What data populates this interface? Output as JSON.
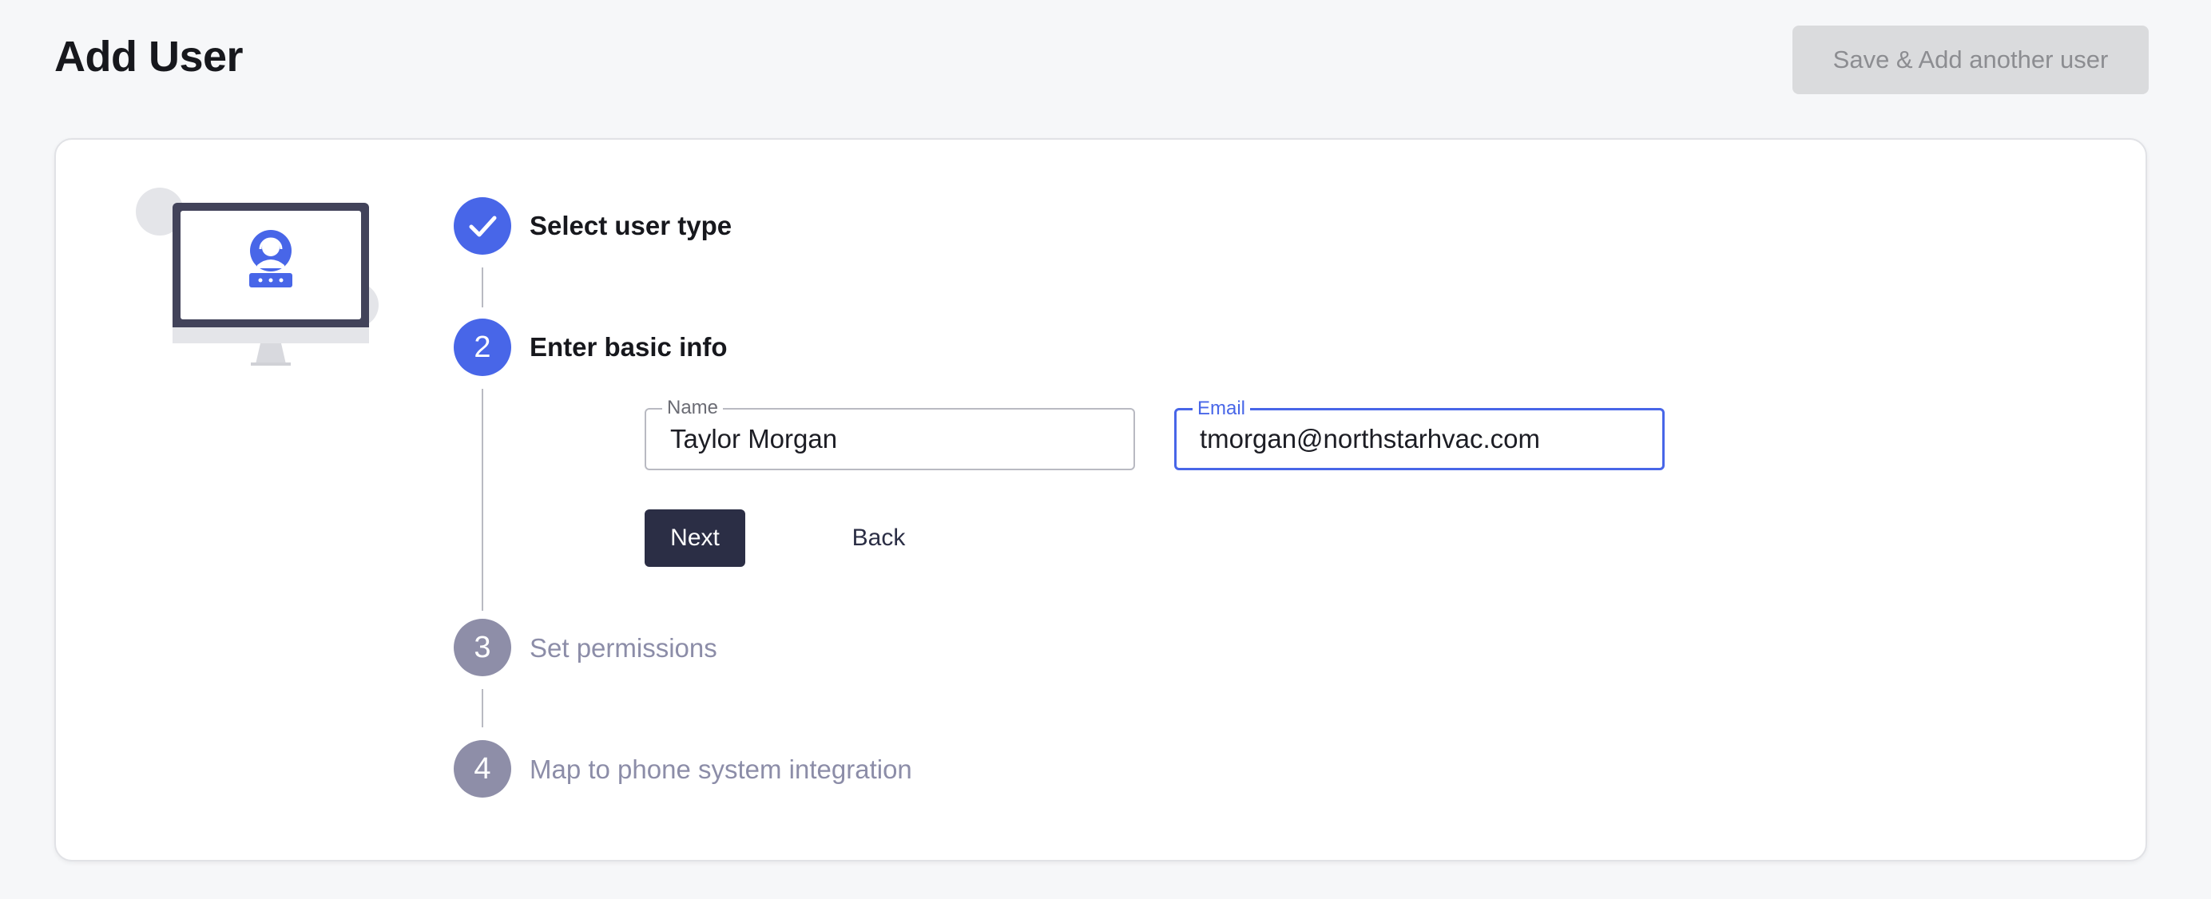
{
  "header": {
    "title": "Add User",
    "save_add_label": "Save & Add another user"
  },
  "steps": [
    {
      "number": "1",
      "label": "Select user type",
      "state": "done"
    },
    {
      "number": "2",
      "label": "Enter basic info",
      "state": "current"
    },
    {
      "number": "3",
      "label": "Set permissions",
      "state": "upcoming"
    },
    {
      "number": "4",
      "label": "Map to phone system integration",
      "state": "upcoming"
    }
  ],
  "form": {
    "name": {
      "label": "Name",
      "value": "Taylor Morgan"
    },
    "email": {
      "label": "Email",
      "value": "tmorgan@northstarhvac.com"
    },
    "next_label": "Next",
    "back_label": "Back"
  },
  "icons": {
    "illustration": "monitor-user-icon",
    "step_done": "check-icon"
  },
  "colors": {
    "accent": "#4866e8",
    "inactive_step": "#8e8ea8",
    "primary_button": "#2b2e45",
    "disabled_button": "#dadbdd"
  }
}
